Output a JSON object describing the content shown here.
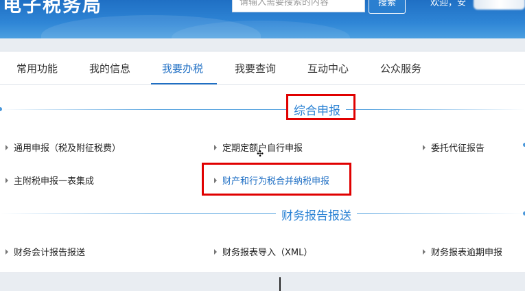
{
  "header": {
    "site_title": "电子税务局",
    "search_placeholder": "请输入需要搜索的内容",
    "search_button": "搜索",
    "welcome_text": "欢迎，安"
  },
  "nav": {
    "tabs": [
      {
        "label": "常用功能"
      },
      {
        "label": "我的信息"
      },
      {
        "label": "我要办税",
        "active": true
      },
      {
        "label": "我要查询"
      },
      {
        "label": "互动中心"
      },
      {
        "label": "公众服务"
      }
    ]
  },
  "sections": [
    {
      "title": "综合申报",
      "items": [
        {
          "label": "通用申报（税及附征税费）"
        },
        {
          "label": "定期定额户自行申报"
        },
        {
          "label": "委托代征报告"
        },
        {
          "label": "主附税申报一表集成"
        },
        {
          "label": "财产和行为税合并纳税申报",
          "highlighted": true
        }
      ]
    },
    {
      "title": "财务报告报送",
      "items": [
        {
          "label": "财务会计报告报送"
        },
        {
          "label": "财务报表导入（XML）"
        },
        {
          "label": "财务报表逾期申报"
        }
      ]
    }
  ],
  "colors": {
    "header_blue": "#2f86d6",
    "accent": "#1f6fc4",
    "highlight_box": "#e00000"
  }
}
